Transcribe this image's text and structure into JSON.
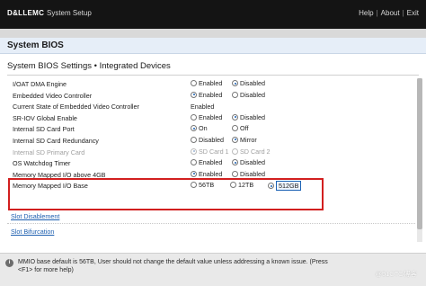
{
  "header": {
    "logo": "D&LLEMC",
    "title": "System Setup",
    "nav": [
      "Help",
      "About",
      "Exit"
    ],
    "nav_sep": "|"
  },
  "page": {
    "title": "System BIOS"
  },
  "section": {
    "title": "System BIOS Settings • Integrated Devices"
  },
  "settings": [
    {
      "label": "I/OAT DMA Engine",
      "options": [
        "Enabled",
        "Disabled"
      ],
      "selected": 1
    },
    {
      "label": "Embedded Video Controller",
      "options": [
        "Enabled",
        "Disabled"
      ],
      "selected": 0
    },
    {
      "label": "Current State of Embedded Video Controller",
      "value": "Enabled"
    },
    {
      "label": "SR-IOV Global Enable",
      "options": [
        "Enabled",
        "Disabled"
      ],
      "selected": 1
    },
    {
      "label": "Internal SD Card Port",
      "options": [
        "On",
        "Off"
      ],
      "selected": 0
    },
    {
      "label": "Internal SD Card Redundancy",
      "options": [
        "Disabled",
        "Mirror"
      ],
      "selected": 1
    },
    {
      "label": "Internal SD Primary Card",
      "options": [
        "SD Card 1",
        "SD Card 2"
      ],
      "selected": 0,
      "disabled": true
    },
    {
      "label": "OS Watchdog Timer",
      "options": [
        "Enabled",
        "Disabled"
      ],
      "selected": 1
    },
    {
      "label": "Memory Mapped I/O above 4GB",
      "options": [
        "Enabled",
        "Disabled"
      ],
      "selected": 0
    },
    {
      "label": "Memory Mapped I/O Base",
      "options": [
        "56TB",
        "12TB",
        "512GB"
      ],
      "selected": 2
    }
  ],
  "links": {
    "slot_disablement": "Slot Disablement",
    "slot_bifurcation": "Slot Bifurcation"
  },
  "help": {
    "icon": "i",
    "text": "MMIO base default is 56TB, User should not change the default value unless addressing a known issue. (Press <F1> for more help)",
    "watermark": "@51CTO博客"
  },
  "colors": {
    "header_bg": "#141414",
    "highlight": "#d21f1f",
    "accent": "#1d63b5"
  }
}
